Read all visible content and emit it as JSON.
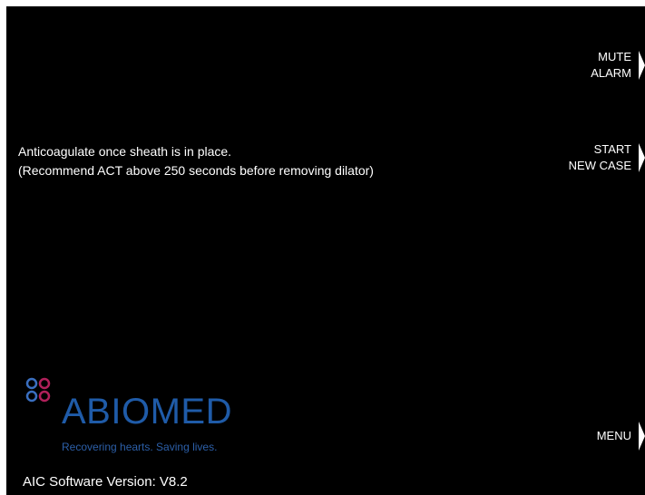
{
  "message": {
    "line1": "Anticoagulate once sheath is in place.",
    "line2": "(Recommend ACT above 250 seconds before removing dilator)"
  },
  "softkeys": {
    "mute_alarm": {
      "line1": "MUTE",
      "line2": "ALARM",
      "icon": "arrow-right-icon"
    },
    "start_new_case": {
      "line1": "START",
      "line2": "NEW CASE",
      "icon": "arrow-right-icon"
    },
    "menu": {
      "label": "MENU",
      "icon": "arrow-right-icon"
    }
  },
  "logo": {
    "brand": "ABIOMED",
    "tagline": "Recovering hearts. Saving lives.",
    "icon": "abiomed-circles-logo",
    "colors": {
      "text": "#1f5ba8",
      "circle_blue": "#3a6fc0",
      "circle_magenta": "#b0205a"
    }
  },
  "footer": {
    "version": "AIC Software Version: V8.2"
  },
  "colors": {
    "background": "#000000",
    "text": "#ffffff"
  }
}
